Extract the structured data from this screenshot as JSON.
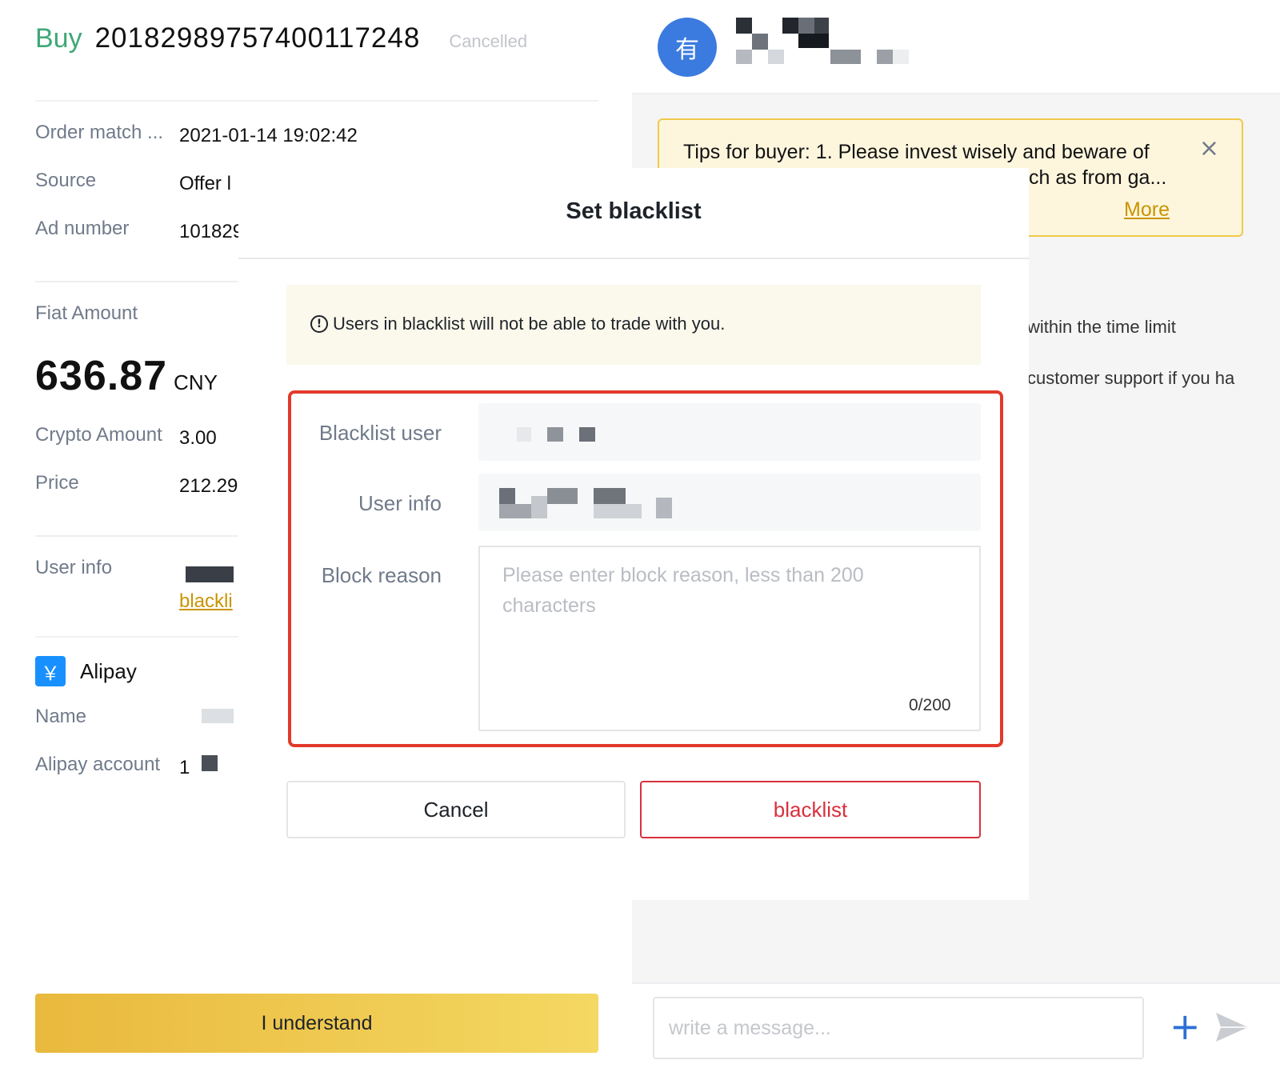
{
  "order": {
    "side": "Buy",
    "number": "20182989757400117248",
    "status": "Cancelled"
  },
  "details": {
    "match_label": "Order match ...",
    "match_value": "2021-01-14 19:02:42",
    "source_label": "Source",
    "source_value": "Offer l",
    "ad_label": "Ad number",
    "ad_value": "101829",
    "fiat_label": "Fiat Amount",
    "fiat_value": "636.87",
    "fiat_currency": "CNY",
    "crypto_label": "Crypto Amount",
    "crypto_value": "3.00",
    "price_label": "Price",
    "price_value": "212.29",
    "userinfo_label": "User info",
    "blacklist_link": "blackli"
  },
  "payment": {
    "method": "Alipay",
    "icon_glyph": "￥",
    "name_label": "Name",
    "account_label": "Alipay account",
    "account_value": "1"
  },
  "understand_button": "I understand",
  "chat": {
    "avatar_char": "有",
    "tips_text": "Tips for buyer: 1. Please invest wisely and beware of",
    "tips_text_line2": "ch as from ga...",
    "tips_more": "More",
    "tips_close": "×",
    "side_line1": "within the time limit",
    "side_line2": "customer support if you ha",
    "message_placeholder": "write a message...",
    "plus_glyph": "+"
  },
  "modal": {
    "title": "Set blacklist",
    "notice_icon": "!",
    "notice": "Users in blacklist will not be able to trade with you.",
    "blacklist_user_label": "Blacklist user",
    "user_info_label": "User info",
    "block_reason_label": "Block reason",
    "block_reason_placeholder": "Please enter block reason, less than 200 characters",
    "counter": "0/200",
    "cancel": "Cancel",
    "confirm": "blacklist"
  },
  "colors": {
    "buy_green": "#3ea877",
    "link_yellow": "#c99400",
    "accent_yellow": "#f0c94a",
    "danger_red": "#d9303d",
    "highlight_red": "#e2392b",
    "avatar_blue": "#3b7be0"
  },
  "icons": {
    "alipay": "alipay-icon",
    "close": "close-icon",
    "info": "info-circle-icon",
    "plus": "plus-icon",
    "send": "send-icon"
  }
}
